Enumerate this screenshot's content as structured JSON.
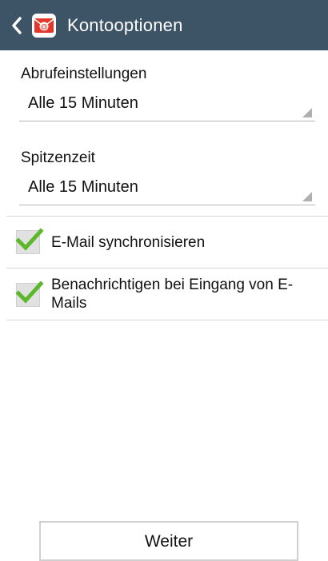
{
  "header": {
    "title": "Kontooptionen",
    "back_icon": "chevron-left-icon",
    "app_icon": "email-app-icon",
    "color": "#3d5366"
  },
  "sync_settings": {
    "label": "Abrufeinstellungen",
    "value": "Alle 15 Minuten"
  },
  "peak_time": {
    "label": "Spitzenzeit",
    "value": "Alle 15 Minuten"
  },
  "options": [
    {
      "label": "E-Mail synchronisieren",
      "checked": true
    },
    {
      "label_line1": "Benachrichtigen bei Eingang von E-",
      "label_line2": "Mails",
      "checked": true
    }
  ],
  "next_button": {
    "label": "Weiter"
  },
  "colors": {
    "check": "#5cb82a",
    "divider": "#d6d6d6"
  }
}
